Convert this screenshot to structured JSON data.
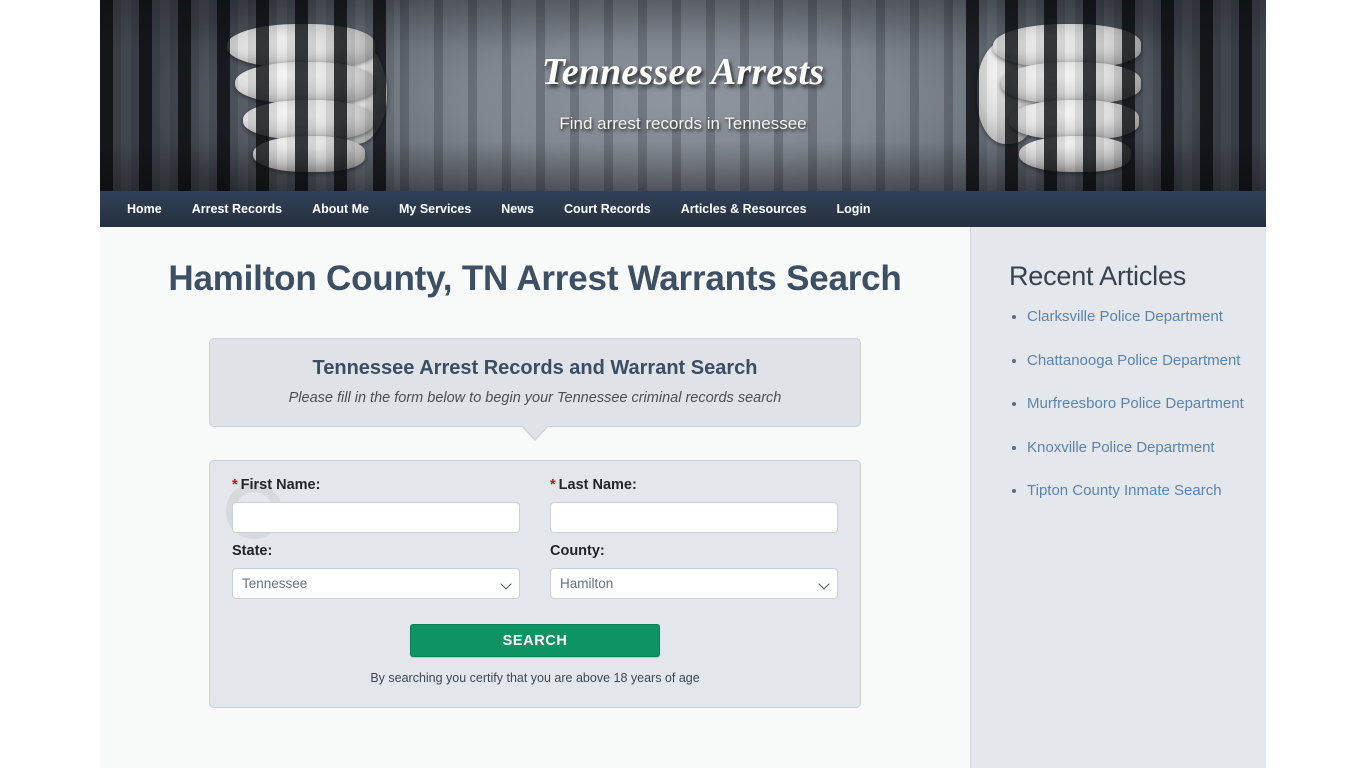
{
  "header": {
    "site_title": "Tennessee Arrests",
    "tagline": "Find arrest records in Tennessee"
  },
  "nav": {
    "items": [
      {
        "label": "Home"
      },
      {
        "label": "Arrest Records"
      },
      {
        "label": "About Me"
      },
      {
        "label": "My Services"
      },
      {
        "label": "News"
      },
      {
        "label": "Court Records"
      },
      {
        "label": "Articles & Resources"
      },
      {
        "label": "Login"
      }
    ]
  },
  "main": {
    "page_title": "Hamilton County, TN Arrest Warrants Search",
    "callout": {
      "title": "Tennessee Arrest Records and Warrant Search",
      "subtitle": "Please fill in the form below to begin your Tennessee criminal records search"
    },
    "form": {
      "first_name": {
        "label": "First Name:",
        "required_marker": "*",
        "value": "",
        "placeholder": ""
      },
      "last_name": {
        "label": "Last Name:",
        "required_marker": "*",
        "value": "",
        "placeholder": ""
      },
      "state": {
        "label": "State:",
        "selected": "Tennessee"
      },
      "county": {
        "label": "County:",
        "selected": "Hamilton"
      },
      "submit_label": "SEARCH",
      "disclaimer": "By searching you certify that you are above 18 years of age"
    }
  },
  "sidebar": {
    "title": "Recent Articles",
    "articles": [
      {
        "label": "Clarksville Police Department"
      },
      {
        "label": "Chattanooga Police Department"
      },
      {
        "label": "Murfreesboro Police Department"
      },
      {
        "label": "Knoxville Police Department"
      },
      {
        "label": "Tipton County Inmate Search"
      }
    ]
  },
  "colors": {
    "nav_bg": "#2a3849",
    "heading": "#3d4f63",
    "link": "#5b84b1",
    "search_button": "#0d9462",
    "required": "#d0021b",
    "sidebar_bg": "#e4e7eb",
    "main_bg": "#f8f9f9"
  }
}
